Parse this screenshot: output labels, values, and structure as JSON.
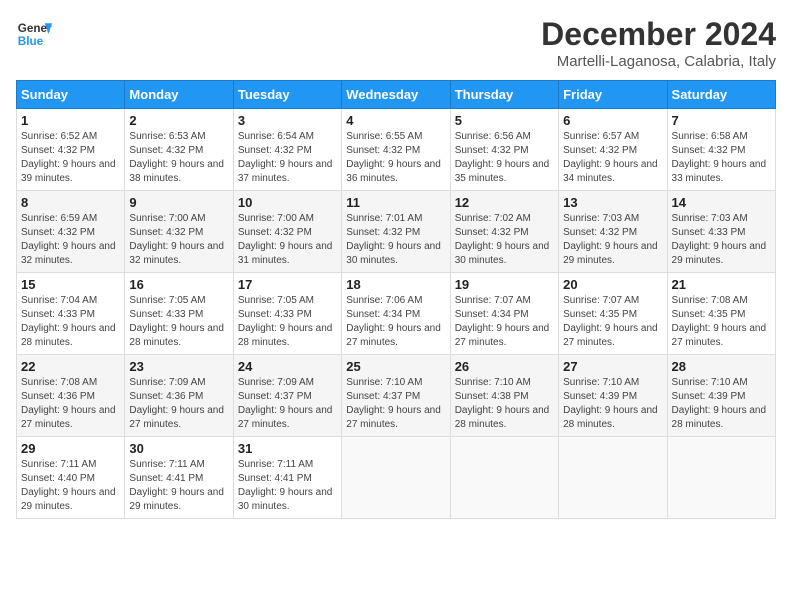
{
  "header": {
    "logo_line1": "General",
    "logo_line2": "Blue",
    "title": "December 2024",
    "subtitle": "Martelli-Laganosa, Calabria, Italy"
  },
  "days_of_week": [
    "Sunday",
    "Monday",
    "Tuesday",
    "Wednesday",
    "Thursday",
    "Friday",
    "Saturday"
  ],
  "weeks": [
    [
      {
        "day": "1",
        "sunrise": "6:52 AM",
        "sunset": "4:32 PM",
        "daylight": "9 hours and 39 minutes."
      },
      {
        "day": "2",
        "sunrise": "6:53 AM",
        "sunset": "4:32 PM",
        "daylight": "9 hours and 38 minutes."
      },
      {
        "day": "3",
        "sunrise": "6:54 AM",
        "sunset": "4:32 PM",
        "daylight": "9 hours and 37 minutes."
      },
      {
        "day": "4",
        "sunrise": "6:55 AM",
        "sunset": "4:32 PM",
        "daylight": "9 hours and 36 minutes."
      },
      {
        "day": "5",
        "sunrise": "6:56 AM",
        "sunset": "4:32 PM",
        "daylight": "9 hours and 35 minutes."
      },
      {
        "day": "6",
        "sunrise": "6:57 AM",
        "sunset": "4:32 PM",
        "daylight": "9 hours and 34 minutes."
      },
      {
        "day": "7",
        "sunrise": "6:58 AM",
        "sunset": "4:32 PM",
        "daylight": "9 hours and 33 minutes."
      }
    ],
    [
      {
        "day": "8",
        "sunrise": "6:59 AM",
        "sunset": "4:32 PM",
        "daylight": "9 hours and 32 minutes."
      },
      {
        "day": "9",
        "sunrise": "7:00 AM",
        "sunset": "4:32 PM",
        "daylight": "9 hours and 32 minutes."
      },
      {
        "day": "10",
        "sunrise": "7:00 AM",
        "sunset": "4:32 PM",
        "daylight": "9 hours and 31 minutes."
      },
      {
        "day": "11",
        "sunrise": "7:01 AM",
        "sunset": "4:32 PM",
        "daylight": "9 hours and 30 minutes."
      },
      {
        "day": "12",
        "sunrise": "7:02 AM",
        "sunset": "4:32 PM",
        "daylight": "9 hours and 30 minutes."
      },
      {
        "day": "13",
        "sunrise": "7:03 AM",
        "sunset": "4:32 PM",
        "daylight": "9 hours and 29 minutes."
      },
      {
        "day": "14",
        "sunrise": "7:03 AM",
        "sunset": "4:33 PM",
        "daylight": "9 hours and 29 minutes."
      }
    ],
    [
      {
        "day": "15",
        "sunrise": "7:04 AM",
        "sunset": "4:33 PM",
        "daylight": "9 hours and 28 minutes."
      },
      {
        "day": "16",
        "sunrise": "7:05 AM",
        "sunset": "4:33 PM",
        "daylight": "9 hours and 28 minutes."
      },
      {
        "day": "17",
        "sunrise": "7:05 AM",
        "sunset": "4:33 PM",
        "daylight": "9 hours and 28 minutes."
      },
      {
        "day": "18",
        "sunrise": "7:06 AM",
        "sunset": "4:34 PM",
        "daylight": "9 hours and 27 minutes."
      },
      {
        "day": "19",
        "sunrise": "7:07 AM",
        "sunset": "4:34 PM",
        "daylight": "9 hours and 27 minutes."
      },
      {
        "day": "20",
        "sunrise": "7:07 AM",
        "sunset": "4:35 PM",
        "daylight": "9 hours and 27 minutes."
      },
      {
        "day": "21",
        "sunrise": "7:08 AM",
        "sunset": "4:35 PM",
        "daylight": "9 hours and 27 minutes."
      }
    ],
    [
      {
        "day": "22",
        "sunrise": "7:08 AM",
        "sunset": "4:36 PM",
        "daylight": "9 hours and 27 minutes."
      },
      {
        "day": "23",
        "sunrise": "7:09 AM",
        "sunset": "4:36 PM",
        "daylight": "9 hours and 27 minutes."
      },
      {
        "day": "24",
        "sunrise": "7:09 AM",
        "sunset": "4:37 PM",
        "daylight": "9 hours and 27 minutes."
      },
      {
        "day": "25",
        "sunrise": "7:10 AM",
        "sunset": "4:37 PM",
        "daylight": "9 hours and 27 minutes."
      },
      {
        "day": "26",
        "sunrise": "7:10 AM",
        "sunset": "4:38 PM",
        "daylight": "9 hours and 28 minutes."
      },
      {
        "day": "27",
        "sunrise": "7:10 AM",
        "sunset": "4:39 PM",
        "daylight": "9 hours and 28 minutes."
      },
      {
        "day": "28",
        "sunrise": "7:10 AM",
        "sunset": "4:39 PM",
        "daylight": "9 hours and 28 minutes."
      }
    ],
    [
      {
        "day": "29",
        "sunrise": "7:11 AM",
        "sunset": "4:40 PM",
        "daylight": "9 hours and 29 minutes."
      },
      {
        "day": "30",
        "sunrise": "7:11 AM",
        "sunset": "4:41 PM",
        "daylight": "9 hours and 29 minutes."
      },
      {
        "day": "31",
        "sunrise": "7:11 AM",
        "sunset": "4:41 PM",
        "daylight": "9 hours and 30 minutes."
      },
      null,
      null,
      null,
      null
    ]
  ],
  "labels": {
    "sunrise": "Sunrise:",
    "sunset": "Sunset:",
    "daylight": "Daylight:"
  }
}
